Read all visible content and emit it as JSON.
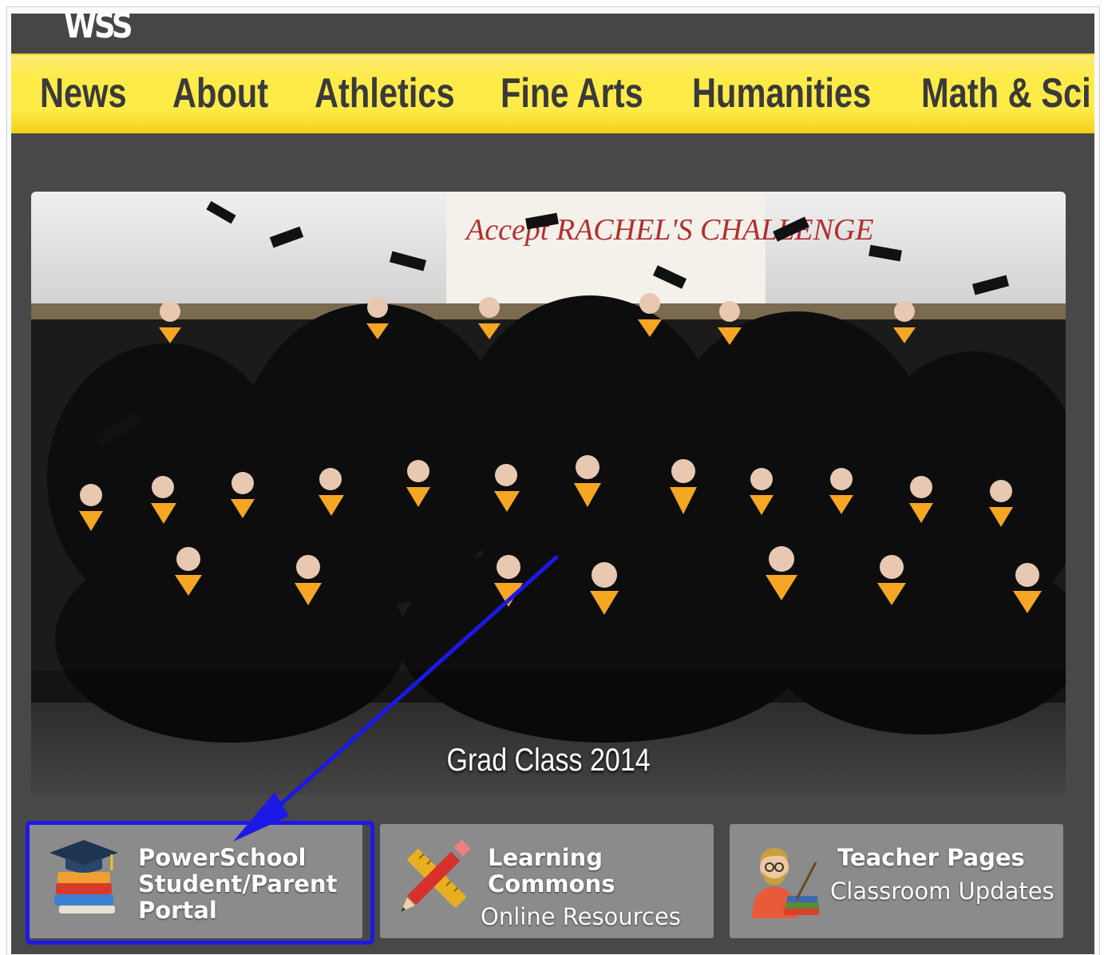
{
  "logo_text": "WSS",
  "nav": {
    "items": [
      "News",
      "About",
      "Athletics",
      "Fine Arts",
      "Humanities",
      "Math & Sci"
    ]
  },
  "hero": {
    "caption": "Grad Class 2014",
    "banner_text": "Accept RACHEL'S CHALLENGE"
  },
  "tiles": [
    {
      "title_lines": [
        "PowerSchool",
        "Student/Parent",
        "Portal"
      ],
      "subtitle": "",
      "icon": "graduation-cap-books-icon"
    },
    {
      "title_lines": [
        "Learning",
        "Commons"
      ],
      "subtitle": "Online Resources",
      "icon": "pencil-ruler-icon"
    },
    {
      "title_lines": [
        "Teacher Pages"
      ],
      "subtitle": "Classroom Updates",
      "icon": "teacher-icon"
    }
  ],
  "colors": {
    "nav_yellow": "#ffeb48",
    "page_bg": "#484848",
    "tile_bg": "#8b8b8b",
    "annotation_blue": "#1c18e8",
    "gown_gold": "#f5a623"
  }
}
